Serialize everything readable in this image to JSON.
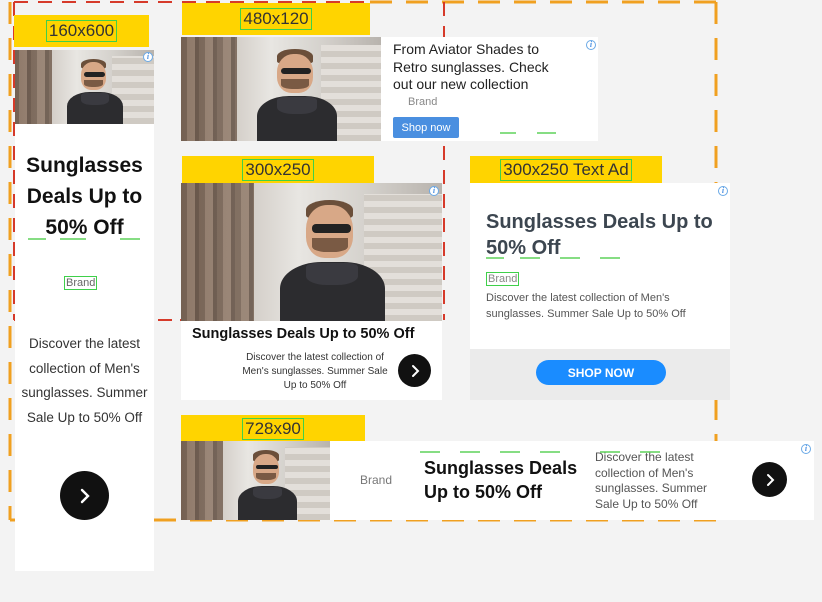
{
  "labels": {
    "s160": "160x600",
    "s480": "480x120",
    "s300": "300x250",
    "s300text": "300x250 Text Ad",
    "s728": "728x90"
  },
  "ad160": {
    "headline": "Sunglasses Deals Up to 50% Off",
    "brand": "Brand",
    "body": "Discover the latest collection of Men's sunglasses. Summer Sale Up to 50% Off"
  },
  "ad480": {
    "body": "From Aviator Shades to Retro sunglasses. Check out our new collection",
    "brand": "Brand",
    "cta": "Shop now"
  },
  "ad300": {
    "headline": "Sunglasses Deals Up to 50% Off",
    "body": "Discover the latest collection of Men's sunglasses. Summer Sale Up to 50% Off"
  },
  "ad300text": {
    "headline": "Sunglasses Deals Up to 50% Off",
    "brand": "Brand",
    "body": "Discover the latest collection of Men's sunglasses. Summer Sale Up to 50% Off",
    "cta": "SHOP NOW"
  },
  "ad728": {
    "brand": "Brand",
    "headline": "Sunglasses Deals Up to 50% Off",
    "body": "Discover the latest collection of Men's sunglasses. Summer Sale Up to 50% Off"
  },
  "icons": {
    "info": "info-icon",
    "next": "chevron-right-icon"
  },
  "colors": {
    "label_bg": "#ffd400",
    "accent_blue": "#1a8cff",
    "shop_blue": "#4a8fe0",
    "info_blue": "#4a90e2",
    "guide_orange": "#f0a020",
    "guide_red": "#d63a2a",
    "highlight_green": "#3fd04a"
  }
}
